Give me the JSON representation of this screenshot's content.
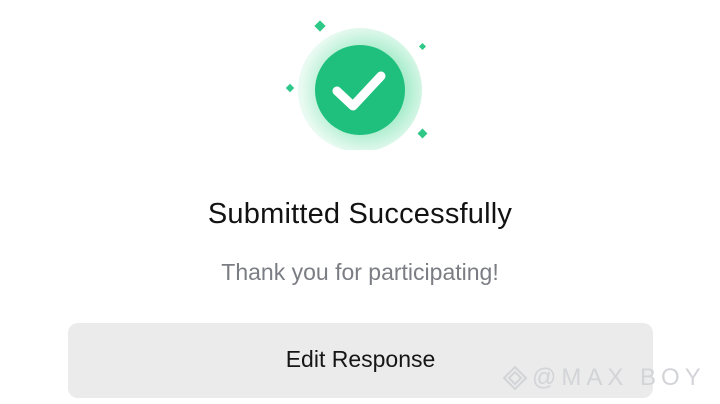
{
  "status": {
    "title": "Submitted Successfully",
    "message": "Thank you for participating!"
  },
  "actions": {
    "edit_label": "Edit Response"
  },
  "watermark": {
    "text": "@MAX BOY"
  },
  "colors": {
    "success_green": "#1fc07d",
    "halo_green": "#bff0d8",
    "sparkle_green": "#2fc889",
    "button_bg": "#ebebeb",
    "title_text": "#121212",
    "subtitle_text": "#7a7d83"
  },
  "icons": {
    "success": "check-circle-icon",
    "sparkle": "sparkle-icon",
    "watermark_logo": "diamond-logo-icon"
  }
}
